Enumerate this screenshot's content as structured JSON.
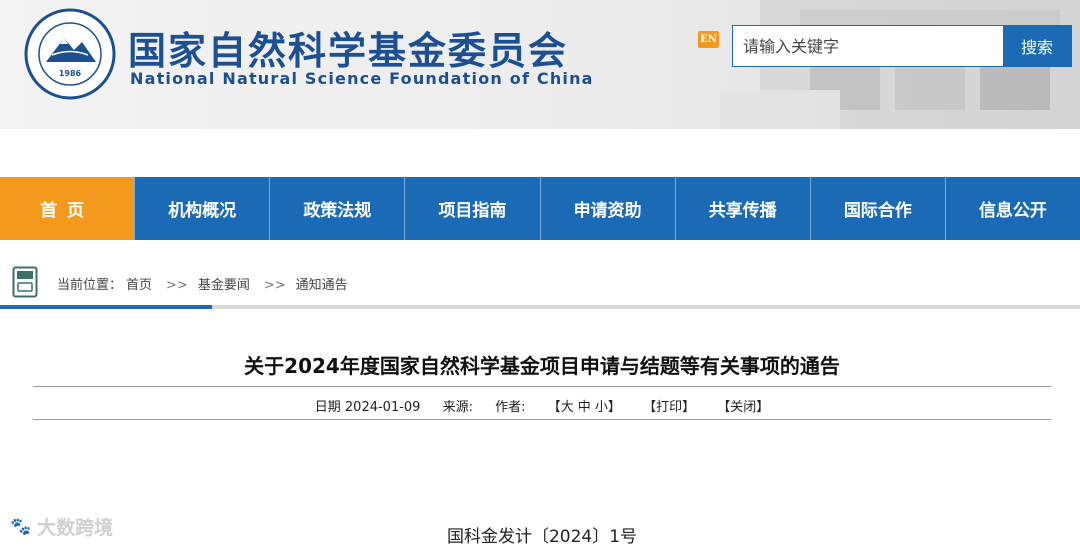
{
  "header": {
    "title_cn": "国家自然科学基金委员会",
    "title_en": "National Natural Science Foundation of China",
    "emblem_year": "1986",
    "lang_badge": "EN",
    "search": {
      "placeholder": "请输入关键字",
      "button": "搜索"
    }
  },
  "nav": {
    "items": [
      {
        "label": "首页",
        "active": true
      },
      {
        "label": "机构概况"
      },
      {
        "label": "政策法规"
      },
      {
        "label": "项目指南"
      },
      {
        "label": "申请资助"
      },
      {
        "label": "共享传播"
      },
      {
        "label": "国际合作"
      },
      {
        "label": "信息公开"
      }
    ]
  },
  "breadcrumb": {
    "prefix": "当前位置：",
    "items": [
      "首页",
      "基金要闻",
      "通知通告"
    ],
    "separator": ">>"
  },
  "article": {
    "title": "关于2024年度国家自然科学基金项目申请与结题等有关事项的通告",
    "meta": {
      "date": "日期 2024-01-09",
      "source": "来源:",
      "author": "作者:",
      "font_size": "【大 中 小】",
      "print": "【打印】",
      "close": "【关闭】"
    },
    "doc_number": "国科金发计〔2024〕1号"
  },
  "watermark": {
    "text": "大数跨境",
    "mark": "🐾"
  },
  "colors": {
    "brand_blue": "#1b6ab5",
    "accent_orange": "#f39a1e",
    "title_blue": "#1d4f93"
  }
}
